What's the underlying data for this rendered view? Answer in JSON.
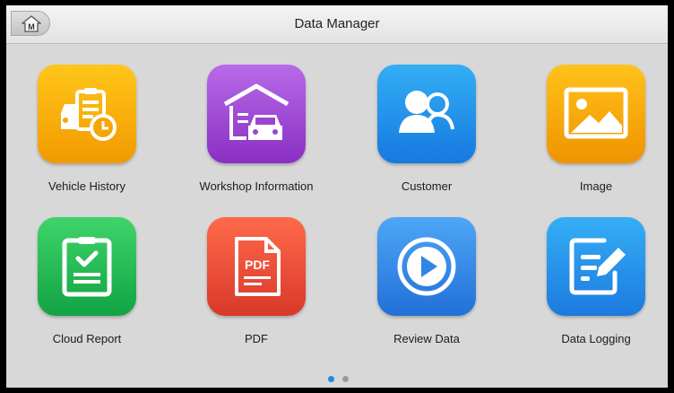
{
  "header": {
    "title": "Data Manager",
    "home_label": "M"
  },
  "apps": [
    {
      "label": "Vehicle History",
      "icon": "vehicle-history-icon",
      "color_top": "#ffc61a",
      "color_bottom": "#f29a00"
    },
    {
      "label": "Workshop Information",
      "icon": "workshop-garage-icon",
      "color_top": "#b86ae8",
      "color_bottom": "#8a2fc4"
    },
    {
      "label": "Customer",
      "icon": "customer-users-icon",
      "color_top": "#34aef5",
      "color_bottom": "#1679e0"
    },
    {
      "label": "Image",
      "icon": "image-icon",
      "color_top": "#ffc21a",
      "color_bottom": "#f09300"
    },
    {
      "label": "Cloud Report",
      "icon": "cloud-report-icon",
      "color_top": "#3fd46a",
      "color_bottom": "#12a343"
    },
    {
      "label": "PDF",
      "icon": "pdf-icon",
      "color_top": "#ff6a4a",
      "color_bottom": "#d9382a"
    },
    {
      "label": "Review Data",
      "icon": "review-play-icon",
      "color_top": "#4ea6f5",
      "color_bottom": "#2270d8"
    },
    {
      "label": "Data Logging",
      "icon": "data-logging-icon",
      "color_top": "#35aef5",
      "color_bottom": "#1c7ae0"
    }
  ],
  "pagination": {
    "pages": 2,
    "current": 1,
    "active_color": "#1e88e5",
    "inactive_color": "#9a9a9a"
  }
}
